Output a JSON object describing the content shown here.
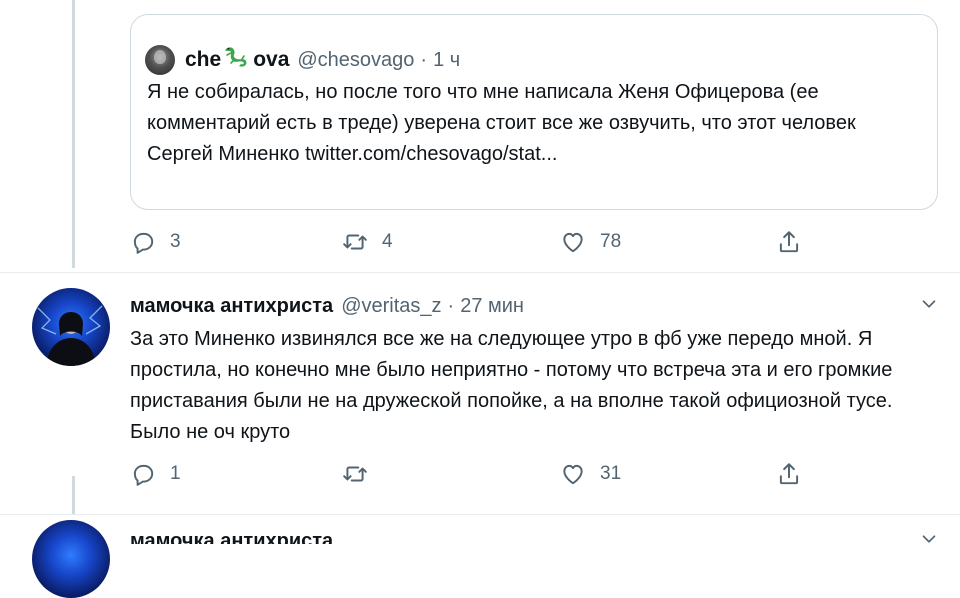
{
  "quoted": {
    "name_part1": "che",
    "name_part2": "ova",
    "emoji_icon": "lizard-icon",
    "handle": "@chesovago",
    "separator": "·",
    "time": "1 ч",
    "text": "Я не собиралась, но после того что мне написала Женя Офицерова (ее комментарий есть в треде) уверена стоит все же озвучить, что этот человек Сергей Миненко twitter.com/chesovago/stat..."
  },
  "actions_top": {
    "reply_count": "3",
    "retweet_count": "4",
    "like_count": "78"
  },
  "tweet": {
    "name": "мамочка антихриста",
    "handle": "@veritas_z",
    "separator": "·",
    "time": "27 мин",
    "text": "За это Миненко извинялся все же на следующее утро в фб уже передо мной. Я простила, но конечно мне было неприятно - потому что встреча эта и его громкие приставания были не на дружеской попойке, а на вполне такой официозной тусе. Было не оч круто"
  },
  "actions_bottom": {
    "reply_count": "1",
    "retweet_count": "",
    "like_count": "31"
  },
  "next_tweet": {
    "name": "мамочка антихриста"
  },
  "colors": {
    "text": "#0f1419",
    "secondary": "#536471",
    "border": "#cfd9de",
    "lizard": "#3aa84a"
  }
}
